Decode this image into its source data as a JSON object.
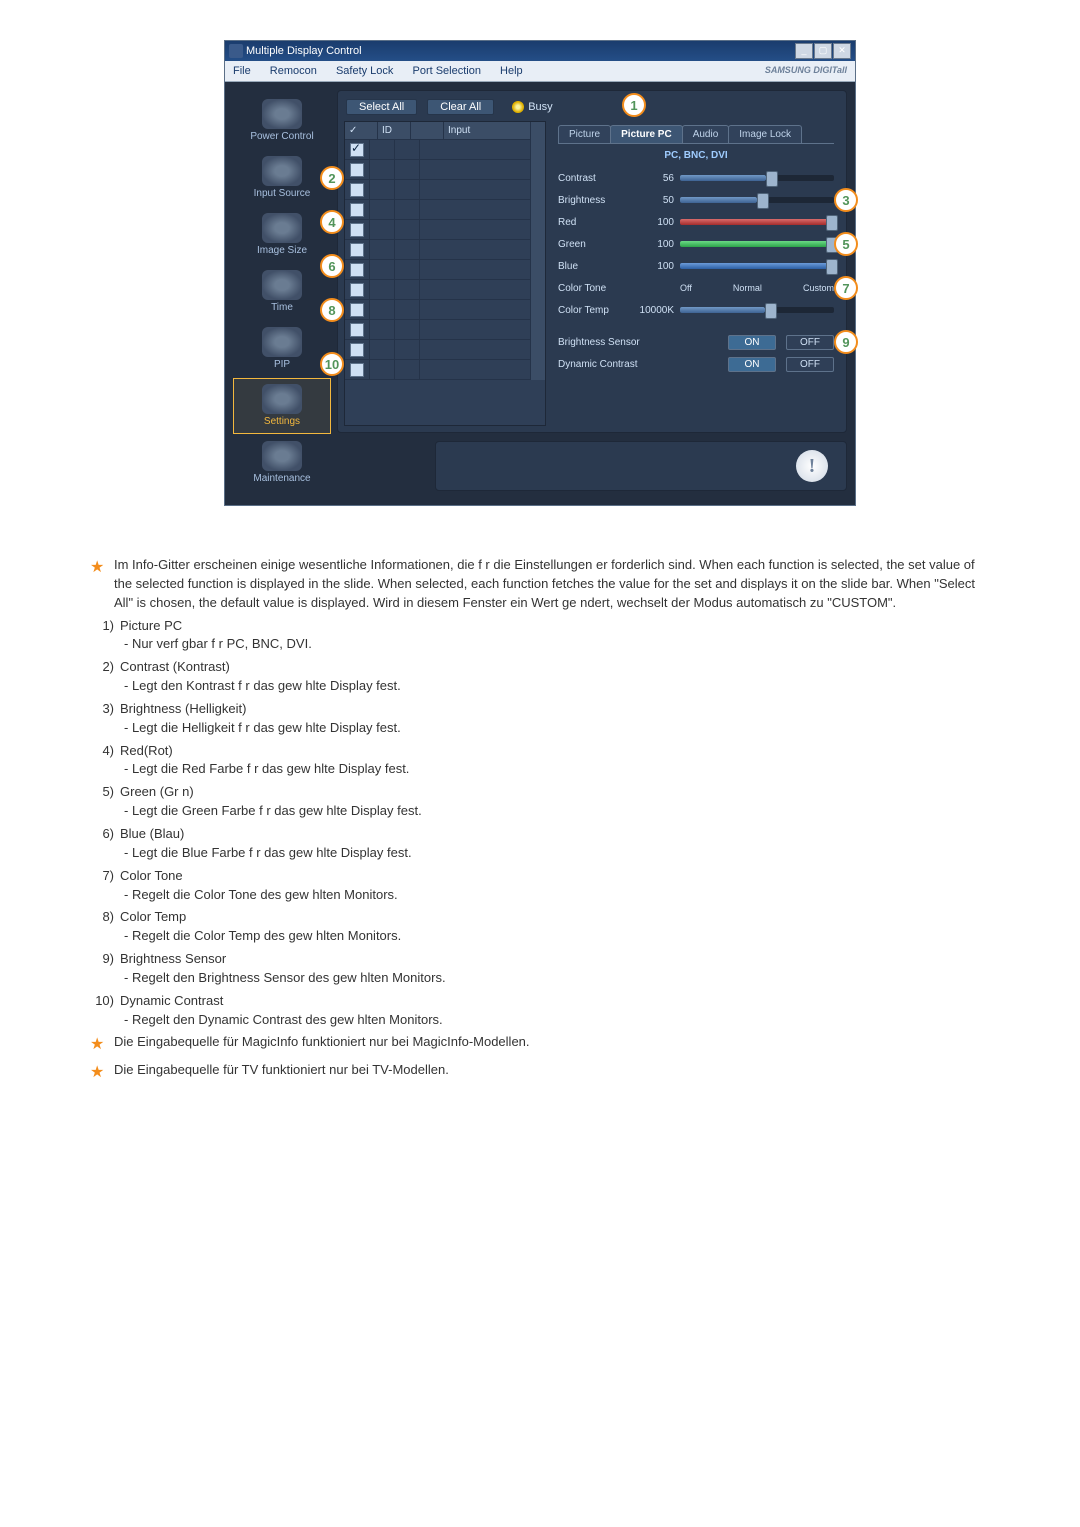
{
  "window": {
    "title": "Multiple Display Control",
    "brand": "SAMSUNG DIGITall"
  },
  "menu": {
    "file": "File",
    "remocon": "Remocon",
    "safety": "Safety Lock",
    "port": "Port Selection",
    "help": "Help"
  },
  "toolbar": {
    "selectall": "Select All",
    "clearall": "Clear All",
    "busy": "Busy"
  },
  "nav": {
    "power": "Power Control",
    "input": "Input Source",
    "image": "Image Size",
    "time": "Time",
    "pip": "PIP",
    "settings": "Settings",
    "maint": "Maintenance"
  },
  "gridhead": {
    "cb": "✓",
    "id": "ID",
    "input": "Input"
  },
  "tabs": {
    "picture": "Picture",
    "picturepc": "Picture PC",
    "audio": "Audio",
    "imagelock": "Image Lock"
  },
  "sources": "PC, BNC, DVI",
  "props": {
    "contrast_label": "Contrast",
    "contrast_val": "56",
    "brightness_label": "Brightness",
    "brightness_val": "50",
    "red_label": "Red",
    "red_val": "100",
    "green_label": "Green",
    "green_val": "100",
    "blue_label": "Blue",
    "blue_val": "100",
    "colortone_label": "Color Tone",
    "colortone_off": "Off",
    "colortone_normal": "Normal",
    "colortone_custom": "Custom",
    "colortemp_label": "Color Temp",
    "colortemp_val": "10000K",
    "bsensor_label": "Brightness Sensor",
    "dyn_label": "Dynamic Contrast",
    "on": "ON",
    "off": "OFF"
  },
  "starnotes": {
    "n1": "Im Info-Gitter erscheinen einige wesentliche Informationen,  die f r die Einstellungen er forderlich sind. When each function is selected, the set value of the selected function is displayed in the slide. When selected, each function fetches the value for the set and displays it on the slide  bar. When \"Select All\" is chosen, the default value is displayed. Wird in diesem Fenster ein Wert ge ndert, wechselt der Modus automatisch zu \"CUSTOM\".",
    "n2": "Die Eingabequelle für MagicInfo funktioniert nur bei MagicInfo-Modellen.",
    "n3": "Die Eingabequelle für TV funktioniert nur bei TV-Modellen."
  },
  "list": {
    "i1_t": "Picture PC",
    "i1_s": "- Nur verf gbar f r PC, BNC, DVI.",
    "i2_t": "Contrast (Kontrast)",
    "i2_s": "- Legt den Kontrast f r das  gew hlte Display fest.",
    "i3_t": "Brightness (Helligkeit)",
    "i3_s": "- Legt die Helligkeit f r das  gew hlte Display fest.",
    "i4_t": "Red(Rot)",
    "i4_s": "- Legt die Red Farbe f r das  gew hlte Display fest.",
    "i5_t": "Green (Gr n)",
    "i5_s": "- Legt die Green Farbe f r das  gew hlte Display fest.",
    "i6_t": "Blue (Blau)",
    "i6_s": "- Legt die Blue Farbe f r das  gew hlte Display fest.",
    "i7_t": "Color Tone",
    "i7_s": "- Regelt die Color Tone des gew hlten Monitors.",
    "i8_t": "Color Temp",
    "i8_s": "- Regelt die Color Temp des gew hlten Monitors.",
    "i9_t": "Brightness Sensor",
    "i9_s": "- Regelt den Brightness Sensor des gew hlten Monitors.",
    "i10_t": "Dynamic Contrast",
    "i10_s": "- Regelt den Dynamic Contrast des gew hlten Monitors."
  },
  "nums": {
    "n1": "1)",
    "n2": "2)",
    "n3": "3)",
    "n4": "4)",
    "n5": "5)",
    "n6": "6)",
    "n7": "7)",
    "n8": "8)",
    "n9": "9)",
    "n10": "10)"
  }
}
